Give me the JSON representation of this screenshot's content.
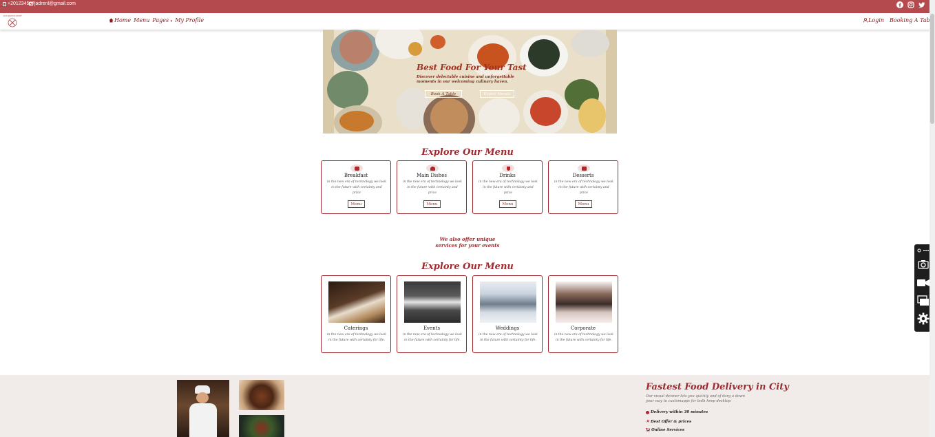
{
  "topbar": {
    "phone": "+201234567",
    "email": "jadrenl@gmail.com",
    "socials": [
      "facebook-icon",
      "instagram-icon",
      "twitter-icon"
    ]
  },
  "navbar": {
    "logo_text": "JOIN RESTAURANT",
    "links": [
      "Home",
      "Menu",
      "Pages",
      "My Profile"
    ],
    "pages_caret": "▾",
    "login": "Login",
    "booking": "Booking A Table"
  },
  "hero": {
    "title": "Best Food For Your Tast",
    "subtitle": "Discover delectable cuisine and unforgettable moments in our welcoming culinary haven.",
    "btn_book": "Book A Table",
    "btn_menu": "Explor Menus"
  },
  "menu_section": {
    "title": "Explore Our Menu",
    "cards": [
      {
        "name": "Breakfast",
        "desc": "in the new era of technology we look in the future with certainty and price",
        "button": "Menu",
        "icon": "coffee-icon"
      },
      {
        "name": "Main Dishes",
        "desc": "in the new era of technology we look in the future with certainty and price",
        "button": "Menu",
        "icon": "dish-icon"
      },
      {
        "name": "Drinks",
        "desc": "in the new era of technology we look in the future with certainty and price",
        "button": "Menu",
        "icon": "wine-glass-icon"
      },
      {
        "name": "Desserts",
        "desc": "in the new era of technology we look in the future with certainty and price",
        "button": "Menu",
        "icon": "cake-icon"
      }
    ]
  },
  "unique": {
    "line1": "We also offer unique",
    "line2": "services for your events"
  },
  "services_section": {
    "title": "Explore Our Menu",
    "cards": [
      {
        "name": "Caterings",
        "desc": "in the new era of technology we look in the future with certainty for life."
      },
      {
        "name": "Events",
        "desc": "in the new era of technology we look in the future with certainty for life."
      },
      {
        "name": "Weddings",
        "desc": "in the new era of technology we look in the future with certainty for life."
      },
      {
        "name": "Corporate",
        "desc": "in the new era of technology we look in the future with certainty for life."
      }
    ]
  },
  "footer": {
    "title": "Fastest Food Delivery in City",
    "subtitle": "Our visual deviner lets you quickly and of darg a down your way to customapps for both keep desktop",
    "features": [
      {
        "label": "Delivery within 30 minutes",
        "icon": "clock-icon"
      },
      {
        "label": "Best Offer & prices",
        "icon": "tag-icon"
      },
      {
        "label": "Online Services",
        "icon": "cart-icon"
      }
    ]
  },
  "colors": {
    "primary": "#b44a4e",
    "accent": "#9e2a2f",
    "footer_bg": "#f1ecea"
  }
}
